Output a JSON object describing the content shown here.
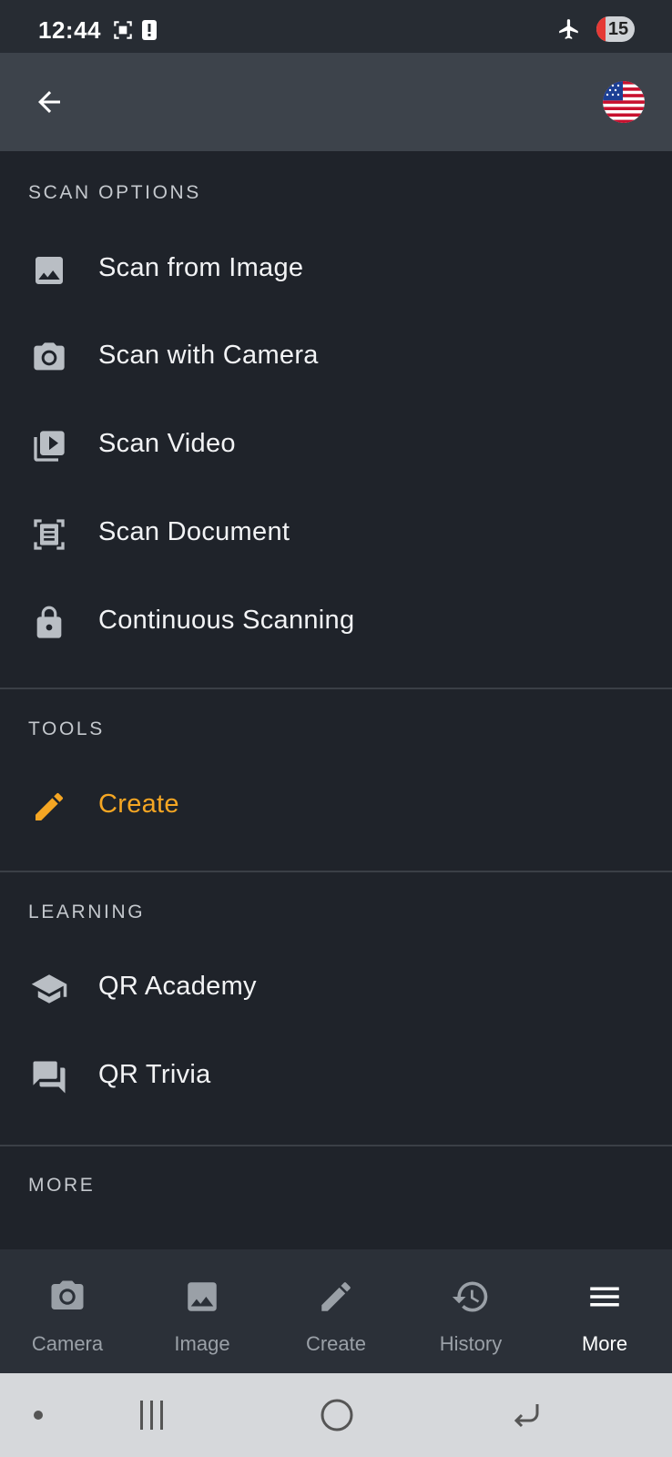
{
  "status_bar": {
    "time": "12:44",
    "battery_level": "15",
    "icons": [
      "screenshot-icon",
      "alert-icon",
      "airplane-mode-icon"
    ]
  },
  "app_bar": {
    "back_icon": "arrow-back-icon",
    "language_icon": "us-flag-icon"
  },
  "sections": {
    "scan_options": {
      "title": "SCAN OPTIONS",
      "items": [
        {
          "label": "Scan from Image",
          "icon": "image-icon"
        },
        {
          "label": "Scan with Camera",
          "icon": "camera-icon"
        },
        {
          "label": "Scan Video",
          "icon": "video-library-icon"
        },
        {
          "label": "Scan Document",
          "icon": "document-scan-icon"
        },
        {
          "label": "Continuous Scanning",
          "icon": "lock-icon"
        }
      ]
    },
    "tools": {
      "title": "TOOLS",
      "items": [
        {
          "label": "Create",
          "icon": "pencil-icon",
          "color": "#f5a623"
        }
      ]
    },
    "learning": {
      "title": "LEARNING",
      "items": [
        {
          "label": "QR Academy",
          "icon": "school-icon"
        },
        {
          "label": "QR Trivia",
          "icon": "forum-icon"
        }
      ]
    },
    "more": {
      "title": "MORE"
    }
  },
  "bottom_nav": {
    "items": [
      {
        "label": "Camera",
        "icon": "camera-icon"
      },
      {
        "label": "Image",
        "icon": "image-icon"
      },
      {
        "label": "Create",
        "icon": "pencil-icon"
      },
      {
        "label": "History",
        "icon": "history-icon"
      },
      {
        "label": "More",
        "icon": "menu-icon",
        "active": true
      }
    ]
  },
  "colors": {
    "background": "#1f232a",
    "app_bar": "#3d434b",
    "accent": "#f5a623",
    "bottom_nav": "#2b3038",
    "system_nav": "#d6d8db"
  }
}
